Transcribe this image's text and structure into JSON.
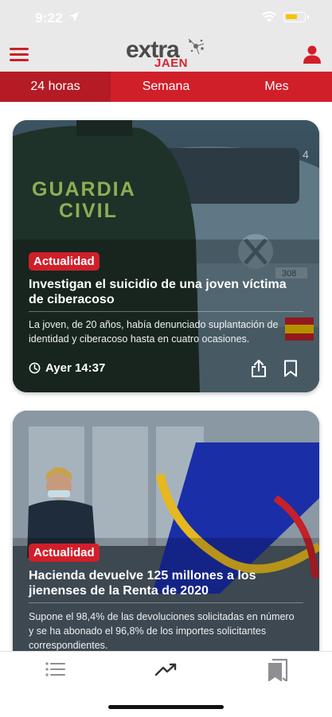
{
  "status_bar": {
    "time": "9:22",
    "battery_color": "#f5c400",
    "icons": [
      "location-arrow-icon",
      "wifi-icon",
      "battery-icon"
    ]
  },
  "header": {
    "logo_main": "extra",
    "logo_sub": "JAEN",
    "menu_icon": "hamburger-menu-icon",
    "user_icon": "user-icon"
  },
  "tabs": [
    {
      "label": "24 horas",
      "active": true
    },
    {
      "label": "Semana",
      "active": false
    },
    {
      "label": "Mes",
      "active": false
    }
  ],
  "articles": [
    {
      "category": "Actualidad",
      "title": "Investigan el suicidio de una joven víctima de ciberacoso",
      "description": "La joven, de 20 años, había denunciado suplantación de identidad y ciberacoso hasta en cuatro ocasiones.",
      "time": "Ayer 14:37",
      "image_text_line1": "GUARDIA",
      "image_text_line2": "CIVIL",
      "image_text_plate": "308",
      "image_text_side": "4"
    },
    {
      "category": "Actualidad",
      "title": "Hacienda devuelve 125 millones a los jienenses de la Renta de 2020",
      "description": "Supone el 98,4% de las devoluciones solicitadas en número y se ha abonado el 96,8% de los importes solicitantes correspondientes."
    }
  ],
  "bottom_nav": [
    {
      "icon": "list-icon",
      "active": false
    },
    {
      "icon": "trending-icon",
      "active": true
    },
    {
      "icon": "bookmarks-icon",
      "active": false
    }
  ],
  "colors": {
    "brand_red": "#d11f2a",
    "header_bg": "#e9e9e9",
    "icon_gray": "#8e8e93",
    "active_icon": "#333333"
  }
}
